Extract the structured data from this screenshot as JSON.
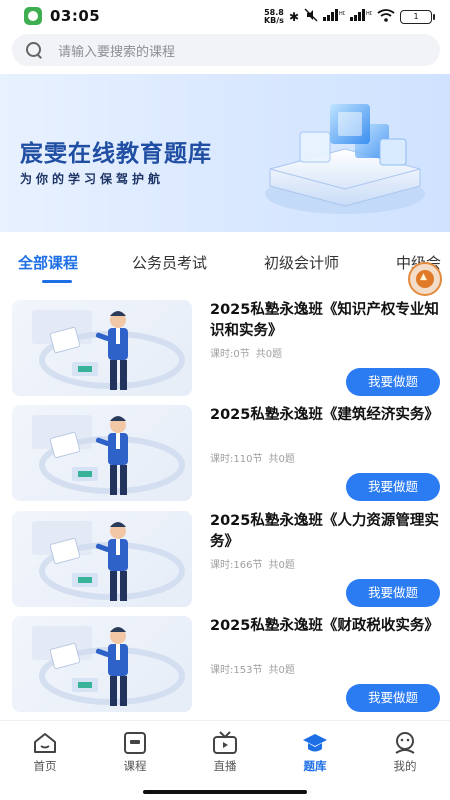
{
  "status_bar": {
    "time": "03:05",
    "net_speed_value": "58.8",
    "net_speed_unit": "KB/s",
    "battery": "1",
    "icons": [
      "bluetooth-icon",
      "mute-icon",
      "hd-signal-icon",
      "wifi-icon",
      "battery-icon"
    ]
  },
  "search": {
    "placeholder": "请输入要搜索的课程"
  },
  "banner": {
    "title": "宸雯在线教育题库",
    "subtitle": "为你的学习保驾护航"
  },
  "tabs": [
    {
      "label": "全部课程",
      "active": true
    },
    {
      "label": "公务员考试",
      "active": false
    },
    {
      "label": "初级会计师",
      "active": false
    },
    {
      "label": "中级会",
      "active": false
    }
  ],
  "courses": [
    {
      "title": "2025私塾永逸班《知识产权专业知识和实务》",
      "hours": "课时:0节",
      "questions": "共0题",
      "button": "我要做题"
    },
    {
      "title": "2025私塾永逸班《建筑经济实务》",
      "hours": "课时:110节",
      "questions": "共0题",
      "button": "我要做题"
    },
    {
      "title": "2025私塾永逸班《人力资源管理实务》",
      "hours": "课时:166节",
      "questions": "共0题",
      "button": "我要做题"
    },
    {
      "title": "2025私塾永逸班《财政税收实务》",
      "hours": "课时:153节",
      "questions": "共0题",
      "button": "我要做题"
    }
  ],
  "bottom_nav": [
    {
      "label": "首页",
      "icon": "home-icon",
      "active": false
    },
    {
      "label": "课程",
      "icon": "course-icon",
      "active": false
    },
    {
      "label": "直播",
      "icon": "tv-icon",
      "active": false
    },
    {
      "label": "题库",
      "icon": "graduation-cap-icon",
      "active": true
    },
    {
      "label": "我的",
      "icon": "profile-icon",
      "active": false
    }
  ],
  "colors": {
    "accent": "#1e6fe6",
    "button": "#2b7bf2",
    "banner_title": "#1f4ea3"
  }
}
